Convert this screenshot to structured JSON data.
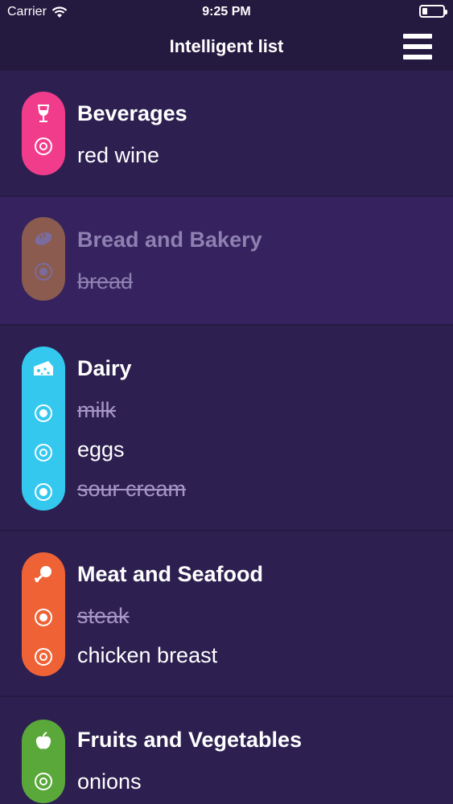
{
  "status_bar": {
    "carrier": "Carrier",
    "time": "9:25 PM",
    "battery_level": 0.25
  },
  "nav": {
    "title": "Intelligent list"
  },
  "colors": {
    "beverages": "#f13c8c",
    "bread": "#a06a4a",
    "dairy": "#34c8ef",
    "meat": "#ee6236",
    "fruits": "#5aa83a"
  },
  "categories": [
    {
      "name": "Beverages",
      "icon": "wine-glass-icon",
      "items": [
        {
          "label": "red wine",
          "done": false
        }
      ]
    },
    {
      "name": "Bread and Bakery",
      "icon": "bread-icon",
      "items": [
        {
          "label": "bread",
          "done": true
        }
      ]
    },
    {
      "name": "Dairy",
      "icon": "cheese-icon",
      "items": [
        {
          "label": "milk",
          "done": true
        },
        {
          "label": "eggs",
          "done": false
        },
        {
          "label": "sour cream",
          "done": true
        }
      ]
    },
    {
      "name": "Meat and Seafood",
      "icon": "meat-icon",
      "items": [
        {
          "label": "steak",
          "done": true
        },
        {
          "label": "chicken breast",
          "done": false
        }
      ]
    },
    {
      "name": "Fruits and Vegetables",
      "icon": "apple-icon",
      "items": [
        {
          "label": "onions",
          "done": false
        }
      ]
    }
  ]
}
